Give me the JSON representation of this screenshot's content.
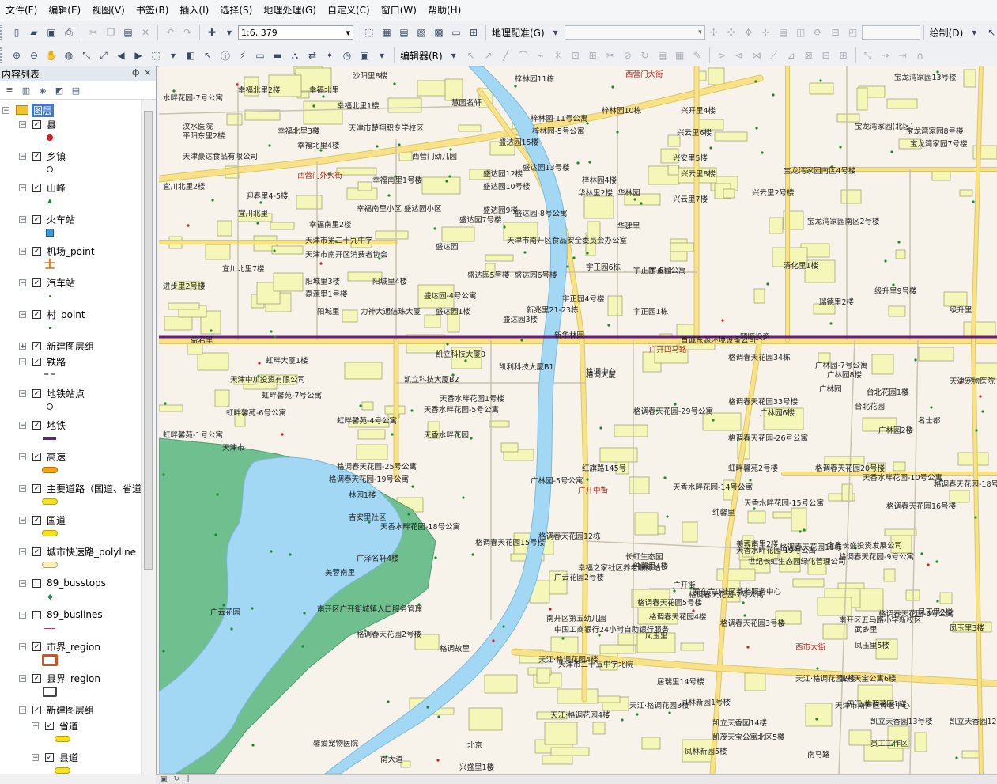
{
  "menu": [
    "文件(F)",
    "编辑(E)",
    "视图(V)",
    "书签(B)",
    "插入(I)",
    "选择(S)",
    "地理处理(G)",
    "自定义(C)",
    "窗口(W)",
    "帮助(H)"
  ],
  "toolbar": {
    "scale": "1:6, 379",
    "georef_label": "地理配准(G)",
    "editor_label": "编辑器(R)",
    "draw_label": "绘制(D)"
  },
  "toc": {
    "title": "内容列表",
    "pin": "ф",
    "close": "×",
    "root": "图层",
    "layers": [
      {
        "name": "县",
        "checked": true
      },
      {
        "name": "乡镇",
        "checked": true
      },
      {
        "name": "山峰",
        "checked": true
      },
      {
        "name": "火车站",
        "checked": true
      },
      {
        "name": "机场_point",
        "checked": true
      },
      {
        "name": "汽车站",
        "checked": true
      },
      {
        "name": "村_point",
        "checked": true
      },
      {
        "name": "新建图层组",
        "checked": true
      },
      {
        "name": "铁路",
        "checked": true
      },
      {
        "name": "地铁站点",
        "checked": true
      },
      {
        "name": "地铁",
        "checked": true
      },
      {
        "name": "高速",
        "checked": true
      },
      {
        "name": "主要道路（国道、省道",
        "checked": true
      },
      {
        "name": "国道",
        "checked": true
      },
      {
        "name": "城市快速路_polyline",
        "checked": true
      },
      {
        "name": "89_busstops",
        "checked": false
      },
      {
        "name": "89_buslines",
        "checked": false
      },
      {
        "name": "市界_region",
        "checked": true
      },
      {
        "name": "县界_region",
        "checked": true
      },
      {
        "name": "新建图层组",
        "checked": true
      },
      {
        "name": "省道",
        "checked": true
      },
      {
        "name": "县道",
        "checked": true
      }
    ]
  },
  "map": {
    "colors": {
      "water": "#a3d8f4",
      "park": "#6fbf8f",
      "building": "#f4f7b8",
      "road": "#f7e28a",
      "metro": "#6a1b8a"
    },
    "labels": [
      {
        "t": "沙阳里8楼"
      },
      {
        "t": "梓林园11栋"
      },
      {
        "t": "西营门大街",
        "road": true
      },
      {
        "t": "宝龙湾家园13号楼"
      },
      {
        "t": "水畔花园-7号公寓"
      },
      {
        "t": "幸福北里2楼"
      },
      {
        "t": "幸福北里"
      },
      {
        "t": "幸福北里1楼"
      },
      {
        "t": "慧园名轩"
      },
      {
        "t": "梓林园-11号公寓"
      },
      {
        "t": "梓林园10栋"
      },
      {
        "t": "兴开里4楼"
      },
      {
        "t": "汶水医院"
      },
      {
        "t": "天津市楚翔职专学校区"
      },
      {
        "t": "梓林园-5号公寓"
      },
      {
        "t": "宝龙湾家园(北区)"
      },
      {
        "t": "宝龙湾家园8号楼"
      },
      {
        "t": "平阳东里2楼"
      },
      {
        "t": "幸福北里3楼"
      },
      {
        "t": "幸福北里4楼"
      },
      {
        "t": "盛达园15楼"
      },
      {
        "t": "兴云里6楼"
      },
      {
        "t": "宝龙湾家园7号楼"
      },
      {
        "t": "天津豪达食品有限公司"
      },
      {
        "t": "西营门幼儿园"
      },
      {
        "t": "兴安里5楼"
      },
      {
        "t": "西营门外大街",
        "road": true
      },
      {
        "t": "盛达园13号楼"
      },
      {
        "t": "兴云里8楼"
      },
      {
        "t": "宝龙湾家园南区4号楼"
      },
      {
        "t": "宜川北里2楼"
      },
      {
        "t": "幸福南里1号楼"
      },
      {
        "t": "盛达园12楼"
      },
      {
        "t": "梓林园4楼"
      },
      {
        "t": "盛达园10号楼"
      },
      {
        "t": "华林里2楼"
      },
      {
        "t": "华林园"
      },
      {
        "t": "兴云里7楼"
      },
      {
        "t": "兴云里2号楼"
      },
      {
        "t": "迎春里4-5楼"
      },
      {
        "t": "幸福南里小区 盛达园小区"
      },
      {
        "t": "盛达园9楼"
      },
      {
        "t": "盛达园-8号公寓"
      },
      {
        "t": "宜川北里"
      },
      {
        "t": "幸福南里2楼"
      },
      {
        "t": "盛达园7号楼"
      },
      {
        "t": "华建里"
      },
      {
        "t": "宝龙湾家园南区2号楼"
      },
      {
        "t": "天津市第二十九中学"
      },
      {
        "t": "天津市南开区食品安全委员会办公室"
      },
      {
        "t": "天津市南开区消费者协会"
      },
      {
        "t": "盛达园"
      },
      {
        "t": "宇正园6栋"
      },
      {
        "t": "宇正园"
      },
      {
        "t": "宇正园-6号公寓"
      },
      {
        "t": "清化里1楼"
      },
      {
        "t": "宜川北里7楼"
      },
      {
        "t": "盛达园5号楼"
      },
      {
        "t": "盛达园6号楼"
      },
      {
        "t": "阳城里3楼"
      },
      {
        "t": "阳城里4楼"
      },
      {
        "t": "进步里2号楼"
      },
      {
        "t": "嘉源里1号楼"
      },
      {
        "t": "盛达园-4号公寓"
      },
      {
        "t": "宇正园4号楼"
      },
      {
        "t": "级升里9号楼"
      },
      {
        "t": "阳城里"
      },
      {
        "t": "力神大通信珠大厦"
      },
      {
        "t": "盛达园1楼"
      },
      {
        "t": "新兆里21-23栋"
      },
      {
        "t": "宇正园1栋"
      },
      {
        "t": "瑞德里2楼"
      },
      {
        "t": "级升里"
      },
      {
        "t": "盛达园3楼"
      },
      {
        "t": "新华林园"
      },
      {
        "t": "首诚东源环境设备公司"
      },
      {
        "t": "颐顺投资"
      },
      {
        "t": "益君里"
      },
      {
        "t": "凯立科技大厦0"
      },
      {
        "t": "广开四马路",
        "road": true
      },
      {
        "t": "虹畔大厦1楼"
      },
      {
        "t": "凯利科技大厦B1"
      },
      {
        "t": "格调中心"
      },
      {
        "t": "格调春天花园34栋"
      },
      {
        "t": "广林园-7号公寓"
      },
      {
        "t": "天津中川投资有限公司"
      },
      {
        "t": "凯立科技大厦B2"
      },
      {
        "t": "格调大厦"
      },
      {
        "t": "广林园8楼"
      },
      {
        "t": "天津宠物医院"
      },
      {
        "t": "虹畔馨苑-7号公寓"
      },
      {
        "t": "天香水畔花园1号楼"
      },
      {
        "t": "格调春天花园33号楼"
      },
      {
        "t": "广林园"
      },
      {
        "t": "台北花园1楼"
      },
      {
        "t": "天香水畔花园-5号公寓"
      },
      {
        "t": "格调春天花园-29号公寓"
      },
      {
        "t": "广林园6楼"
      },
      {
        "t": "台北花园"
      },
      {
        "t": "虹畔馨苑-6号公寓"
      },
      {
        "t": "虹畔馨苑-4号公寓"
      },
      {
        "t": "名士都"
      },
      {
        "t": "天香水畔花园"
      },
      {
        "t": "格调春天花园-26号公寓"
      },
      {
        "t": "广林园2楼"
      },
      {
        "t": "虹畔馨苑-1号公寓"
      },
      {
        "t": "天津市"
      },
      {
        "t": "格调春天花园-25号公寓"
      },
      {
        "t": "红旗路145号"
      },
      {
        "t": "虹畔馨苑2号楼"
      },
      {
        "t": "格调春天花园20号楼"
      },
      {
        "t": "格调春天花园-19号公寓"
      },
      {
        "t": "广林园-5号公寓"
      },
      {
        "t": "天香水畔花园-14号公寓"
      },
      {
        "t": "天香水畔花园-10号公寓"
      },
      {
        "t": "格调春天花园-18号公寓"
      },
      {
        "t": "林园1楼"
      },
      {
        "t": "广开中街",
        "road": true
      },
      {
        "t": "天香水畔花园-15号公寓"
      },
      {
        "t": "格调春天花园16号楼"
      },
      {
        "t": "吉安里社区"
      },
      {
        "t": "纯馨里"
      },
      {
        "t": "天香水畔花园-18号公寓"
      },
      {
        "t": "格调春天花园12栋"
      },
      {
        "t": "天香水畔花园-19号公寓"
      },
      {
        "t": "格调春天花园15号楼"
      },
      {
        "t": "美蓉南里2楼"
      },
      {
        "t": "格调春天花园11栋"
      },
      {
        "t": "金鑫长盛投资发展公司"
      },
      {
        "t": "格调春天花园-9号公寓"
      },
      {
        "t": "广泽名轩4楼"
      },
      {
        "t": "纯馨里4楼"
      },
      {
        "t": "世纪长虹生态园绿化管理公司"
      },
      {
        "t": "格调春天花园-7号公寓"
      },
      {
        "t": "广开街"
      },
      {
        "t": "幸福之家社区养老服务站"
      },
      {
        "t": "美蓉南里"
      },
      {
        "t": "广云花园2号楼"
      },
      {
        "t": "长虹生态园"
      },
      {
        "t": "爱在六Q社区养老服务中心"
      },
      {
        "t": "格调春天花园-6号公寓"
      },
      {
        "t": "格调春天花园5号楼"
      },
      {
        "t": "广云花园"
      },
      {
        "t": "南开区广开街城镇人口服务管理"
      },
      {
        "t": "南开区第五幼儿园"
      },
      {
        "t": "格调春天花园4楼"
      },
      {
        "t": "凤玉里2楼"
      },
      {
        "t": "南开区五马路小学新校区"
      },
      {
        "t": "中国工商银行24小时自助银行服务"
      },
      {
        "t": "格调春天花园3号楼"
      },
      {
        "t": "武乡里"
      },
      {
        "t": "凤玉里3楼"
      },
      {
        "t": "格调春天花园2号楼"
      },
      {
        "t": "凤玉里"
      },
      {
        "t": "格调故里"
      },
      {
        "t": "西市大街",
        "road": true
      },
      {
        "t": "凤玉里5楼"
      },
      {
        "t": "居瑞里14号楼"
      },
      {
        "t": "天江·格调花园2楼"
      },
      {
        "t": "天江·格调花园4楼"
      },
      {
        "t": "天津市二十五中学北院"
      },
      {
        "t": "凯兴天宝公寓6楼"
      },
      {
        "t": "天江·格调花园1楼"
      },
      {
        "t": "凤林新园1号楼"
      },
      {
        "t": "天江·格调花园3楼"
      },
      {
        "t": "天津市南开区养老中心"
      },
      {
        "t": "凯立天香园13号楼"
      },
      {
        "t": "天江·格调花园4楼"
      },
      {
        "t": "凯立天香园14楼"
      },
      {
        "t": "凯立天香园12楼"
      },
      {
        "t": "凯茂天宝公寓北区5楼"
      },
      {
        "t": "员工工作区"
      },
      {
        "t": "馨爱宠物医院"
      },
      {
        "t": "北京"
      },
      {
        "t": "凤林新园5楼"
      },
      {
        "t": "南马路"
      },
      {
        "t": "南大道"
      },
      {
        "t": "兴盛里1楼"
      }
    ]
  }
}
